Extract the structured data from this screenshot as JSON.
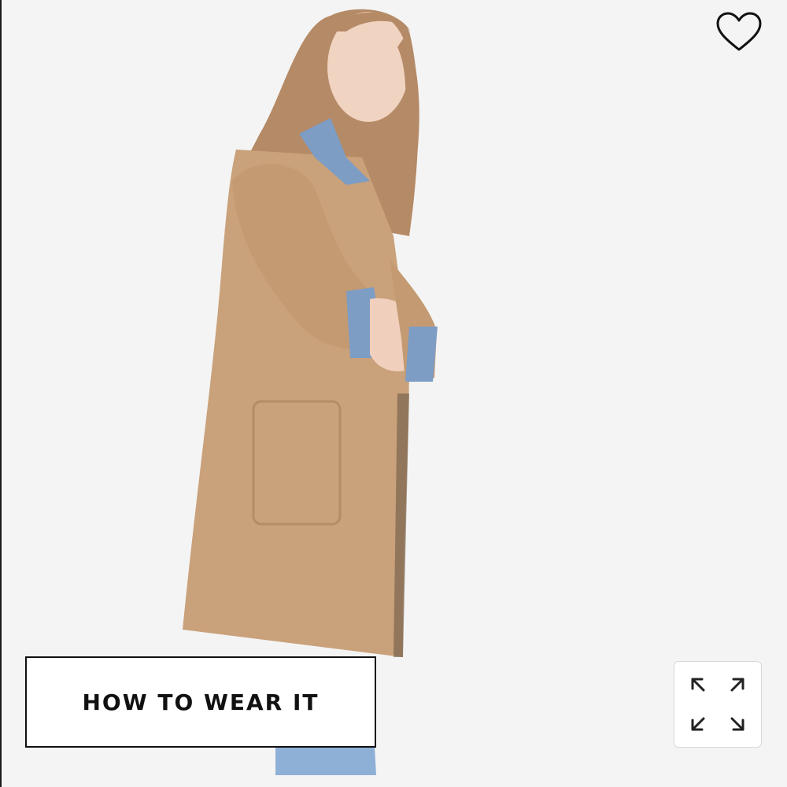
{
  "product_image": {
    "subject": "model-in-camel-coat",
    "colors": {
      "background": "#f4f4f4",
      "coat": "#c9a17a",
      "denim": "#7d9dc4",
      "hair": "#b58a66",
      "skin": "#f0d3c0"
    }
  },
  "wishlist": {
    "icon": "heart-icon"
  },
  "how_to_wear": {
    "label": "HOW TO WEAR IT"
  },
  "expand": {
    "icon": "expand-arrows-icon"
  }
}
